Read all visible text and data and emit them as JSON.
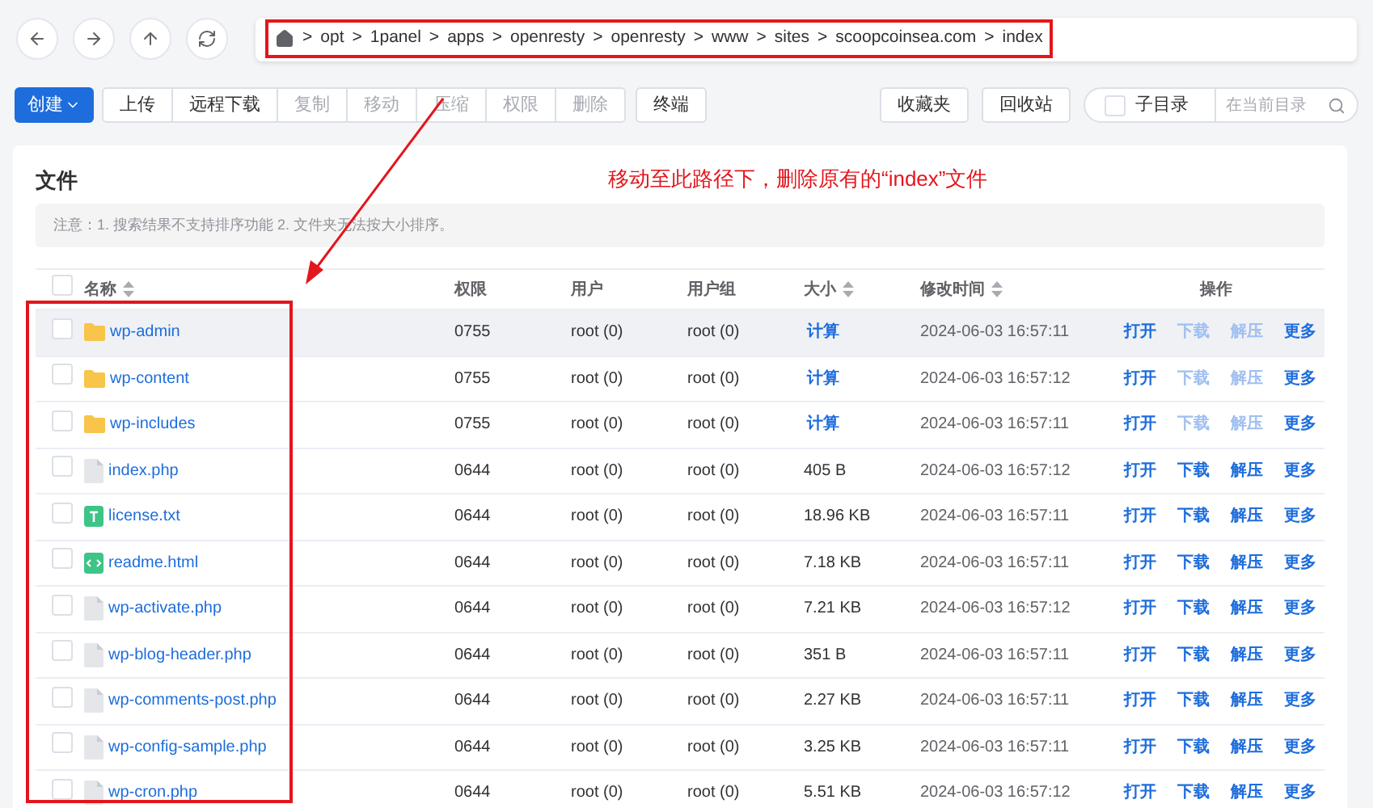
{
  "breadcrumb": {
    "separator": ">",
    "segments": [
      "opt",
      "1panel",
      "apps",
      "openresty",
      "openresty",
      "www",
      "sites",
      "scoopcoinsea.com",
      "index"
    ]
  },
  "toolbar": {
    "left": [
      {
        "label": "创建",
        "kind": "primary",
        "disabled": false
      },
      {
        "label": "上传",
        "kind": "default",
        "disabled": false
      },
      {
        "label": "远程下载",
        "kind": "default",
        "disabled": false
      },
      {
        "label": "复制",
        "kind": "default",
        "disabled": true
      },
      {
        "label": "移动",
        "kind": "default",
        "disabled": true
      },
      {
        "label": "压缩",
        "kind": "default",
        "disabled": true
      },
      {
        "label": "权限",
        "kind": "default",
        "disabled": true
      },
      {
        "label": "删除",
        "kind": "default",
        "disabled": true
      },
      {
        "label": "终端",
        "kind": "standalone",
        "disabled": false
      }
    ],
    "right": [
      "收藏夹",
      "回收站"
    ],
    "subdir": {
      "label": "子目录",
      "checked": false
    },
    "search": {
      "placeholder": "在当前目录"
    }
  },
  "card": {
    "title": "文件",
    "notice": "注意：1. 搜索结果不支持排序功能 2. 文件夹无法按大小排序。"
  },
  "table": {
    "all_checked": false,
    "columns": [
      {
        "label": "名称",
        "sortable": true
      },
      {
        "label": "权限",
        "sortable": false
      },
      {
        "label": "用户",
        "sortable": false
      },
      {
        "label": "用户组",
        "sortable": false
      },
      {
        "label": "大小",
        "sortable": true
      },
      {
        "label": "修改时间",
        "sortable": true
      },
      {
        "label": "操作",
        "sortable": false
      }
    ],
    "rows": [
      {
        "name": "wp-admin",
        "kind": "folder",
        "perm": "0755",
        "user": "root (0)",
        "group": "root (0)",
        "size": "计算",
        "size_link": true,
        "time": "2024-06-03 16:57:11",
        "hovered": true,
        "checked": false,
        "actions": [
          {
            "label": "打开",
            "disabled": false
          },
          {
            "label": "下载",
            "disabled": true
          },
          {
            "label": "解压",
            "disabled": true
          },
          {
            "label": "更多",
            "disabled": false
          }
        ]
      },
      {
        "name": "wp-content",
        "kind": "folder",
        "perm": "0755",
        "user": "root (0)",
        "group": "root (0)",
        "size": "计算",
        "size_link": true,
        "time": "2024-06-03 16:57:12",
        "hovered": false,
        "checked": false,
        "actions": [
          {
            "label": "打开",
            "disabled": false
          },
          {
            "label": "下载",
            "disabled": true
          },
          {
            "label": "解压",
            "disabled": true
          },
          {
            "label": "更多",
            "disabled": false
          }
        ]
      },
      {
        "name": "wp-includes",
        "kind": "folder",
        "perm": "0755",
        "user": "root (0)",
        "group": "root (0)",
        "size": "计算",
        "size_link": true,
        "time": "2024-06-03 16:57:11",
        "hovered": false,
        "checked": false,
        "actions": [
          {
            "label": "打开",
            "disabled": false
          },
          {
            "label": "下载",
            "disabled": true
          },
          {
            "label": "解压",
            "disabled": true
          },
          {
            "label": "更多",
            "disabled": false
          }
        ]
      },
      {
        "name": "index.php",
        "kind": "file",
        "perm": "0644",
        "user": "root (0)",
        "group": "root (0)",
        "size": "405 B",
        "size_link": false,
        "time": "2024-06-03 16:57:12",
        "hovered": false,
        "checked": false,
        "actions": [
          {
            "label": "打开",
            "disabled": false
          },
          {
            "label": "下载",
            "disabled": false
          },
          {
            "label": "解压",
            "disabled": false
          },
          {
            "label": "更多",
            "disabled": false
          }
        ]
      },
      {
        "name": "license.txt",
        "kind": "text",
        "perm": "0644",
        "user": "root (0)",
        "group": "root (0)",
        "size": "18.96 KB",
        "size_link": false,
        "time": "2024-06-03 16:57:11",
        "hovered": false,
        "checked": false,
        "actions": [
          {
            "label": "打开",
            "disabled": false
          },
          {
            "label": "下载",
            "disabled": false
          },
          {
            "label": "解压",
            "disabled": false
          },
          {
            "label": "更多",
            "disabled": false
          }
        ]
      },
      {
        "name": "readme.html",
        "kind": "html",
        "perm": "0644",
        "user": "root (0)",
        "group": "root (0)",
        "size": "7.18 KB",
        "size_link": false,
        "time": "2024-06-03 16:57:11",
        "hovered": false,
        "checked": false,
        "actions": [
          {
            "label": "打开",
            "disabled": false
          },
          {
            "label": "下载",
            "disabled": false
          },
          {
            "label": "解压",
            "disabled": false
          },
          {
            "label": "更多",
            "disabled": false
          }
        ]
      },
      {
        "name": "wp-activate.php",
        "kind": "file",
        "perm": "0644",
        "user": "root (0)",
        "group": "root (0)",
        "size": "7.21 KB",
        "size_link": false,
        "time": "2024-06-03 16:57:12",
        "hovered": false,
        "checked": false,
        "actions": [
          {
            "label": "打开",
            "disabled": false
          },
          {
            "label": "下载",
            "disabled": false
          },
          {
            "label": "解压",
            "disabled": false
          },
          {
            "label": "更多",
            "disabled": false
          }
        ]
      },
      {
        "name": "wp-blog-header.php",
        "kind": "file",
        "perm": "0644",
        "user": "root (0)",
        "group": "root (0)",
        "size": "351 B",
        "size_link": false,
        "time": "2024-06-03 16:57:11",
        "hovered": false,
        "checked": false,
        "actions": [
          {
            "label": "打开",
            "disabled": false
          },
          {
            "label": "下载",
            "disabled": false
          },
          {
            "label": "解压",
            "disabled": false
          },
          {
            "label": "更多",
            "disabled": false
          }
        ]
      },
      {
        "name": "wp-comments-post.php",
        "kind": "file",
        "perm": "0644",
        "user": "root (0)",
        "group": "root (0)",
        "size": "2.27 KB",
        "size_link": false,
        "time": "2024-06-03 16:57:11",
        "hovered": false,
        "checked": false,
        "actions": [
          {
            "label": "打开",
            "disabled": false
          },
          {
            "label": "下载",
            "disabled": false
          },
          {
            "label": "解压",
            "disabled": false
          },
          {
            "label": "更多",
            "disabled": false
          }
        ]
      },
      {
        "name": "wp-config-sample.php",
        "kind": "file",
        "perm": "0644",
        "user": "root (0)",
        "group": "root (0)",
        "size": "3.25 KB",
        "size_link": false,
        "time": "2024-06-03 16:57:11",
        "hovered": false,
        "checked": false,
        "actions": [
          {
            "label": "打开",
            "disabled": false
          },
          {
            "label": "下载",
            "disabled": false
          },
          {
            "label": "解压",
            "disabled": false
          },
          {
            "label": "更多",
            "disabled": false
          }
        ]
      },
      {
        "name": "wp-cron.php",
        "kind": "file",
        "perm": "0644",
        "user": "root (0)",
        "group": "root (0)",
        "size": "5.51 KB",
        "size_link": false,
        "time": "2024-06-03 16:57:12",
        "hovered": false,
        "checked": false,
        "actions": [
          {
            "label": "打开",
            "disabled": false
          },
          {
            "label": "下载",
            "disabled": false
          },
          {
            "label": "解压",
            "disabled": false
          },
          {
            "label": "更多",
            "disabled": false
          }
        ]
      }
    ]
  },
  "annotation": {
    "text": "移动至此路径下，删除原有的“index”文件"
  }
}
